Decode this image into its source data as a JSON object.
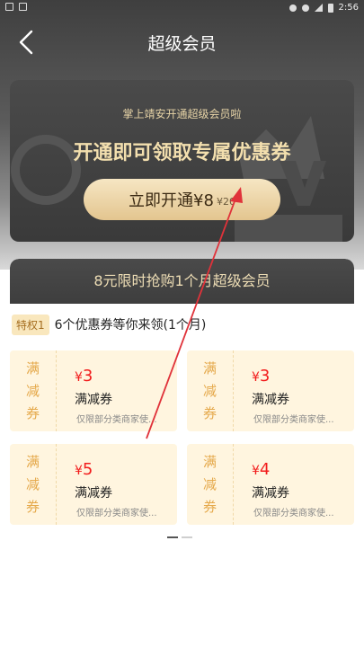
{
  "status_bar": {
    "time": "2:56"
  },
  "nav": {
    "title": "超级会员"
  },
  "promo": {
    "subtitle": "掌上靖安开通超级会员啦",
    "headline": "开通即可领取专属优惠券",
    "button_label": "立即开通¥8",
    "original_price": "¥20"
  },
  "panel": {
    "heading": "8元限时抢购1个月超级会员",
    "privilege_tag": "特权1",
    "privilege_text": "6个优惠券等你来领(1个月)"
  },
  "coupons": [
    {
      "side": [
        "满",
        "减",
        "券"
      ],
      "amount": "3",
      "name": "满减券",
      "note": "仅限部分类商家使..."
    },
    {
      "side": [
        "满",
        "减",
        "券"
      ],
      "amount": "3",
      "name": "满减券",
      "note": "仅限部分类商家使..."
    },
    {
      "side": [
        "满",
        "减",
        "券"
      ],
      "amount": "5",
      "name": "满减券",
      "note": "仅限部分类商家使..."
    },
    {
      "side": [
        "满",
        "减",
        "券"
      ],
      "amount": "4",
      "name": "满减券",
      "note": "仅限部分类商家使..."
    }
  ],
  "currency_symbol": "¥",
  "pager": {
    "pages": 2,
    "current": 1
  },
  "colors": {
    "gold_text": "#f3dfae",
    "button_gold": "#e3c58f",
    "coupon_bg": "#fff5df",
    "amount_red": "#f21c1c",
    "annotation_red": "#e0323a"
  }
}
